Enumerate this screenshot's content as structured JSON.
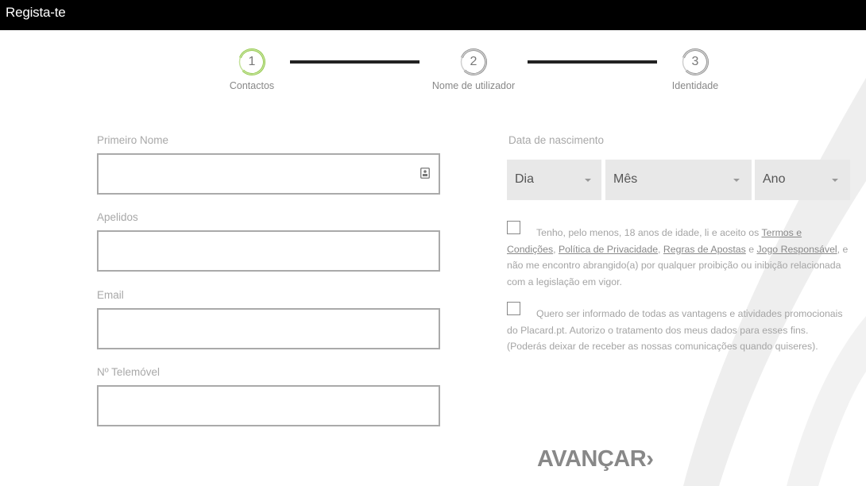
{
  "header": {
    "title": "Regista-te"
  },
  "stepper": {
    "steps": [
      {
        "number": "1",
        "label": "Contactos",
        "state": "active"
      },
      {
        "number": "2",
        "label": "Nome de utilizador",
        "state": "pending"
      },
      {
        "number": "3",
        "label": "Identidade",
        "state": "pending"
      }
    ]
  },
  "form": {
    "first_name": {
      "label": "Primeiro Nome",
      "value": ""
    },
    "surname": {
      "label": "Apelidos",
      "value": ""
    },
    "email": {
      "label": "Email",
      "value": ""
    },
    "phone": {
      "label": "Nº Telemóvel",
      "value": ""
    },
    "birth": {
      "label": "Data de nascimento",
      "day": "Dia",
      "month": "Mês",
      "year": "Ano"
    },
    "terms": {
      "prefix": "Tenho, pelo menos, 18 anos de idade, li e aceito os ",
      "link_terms": "Termos e Condições",
      "sep1": ", ",
      "link_privacy": "Política de Privacidade",
      "sep2": ", ",
      "link_rules": "Regras de Apostas",
      "sep3": " e ",
      "link_responsible": "Jogo Responsável",
      "suffix": ", e não me encontro abrangido(a) por qualquer proibição ou inibição relacionada com a legislação em vigor."
    },
    "marketing": {
      "text": "Quero ser informado de todas as vantagens e atividades promocionais do Placard.pt. Autorizo o tratamento dos meus dados para esses fins. (Poderás deixar de receber as nossas comunicações quando quiseres)."
    },
    "submit_label": "AVANÇAR›"
  },
  "colors": {
    "header_bg": "#000000",
    "active_step": "#8cc63f",
    "connector": "#222222",
    "select_bg": "#e8e8e8"
  }
}
